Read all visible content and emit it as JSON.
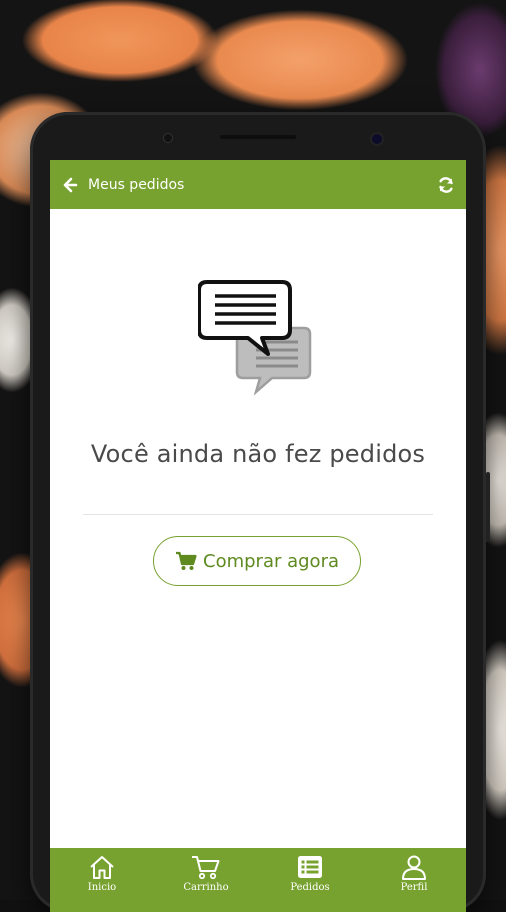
{
  "appbar": {
    "title": "Meus pedidos",
    "back_icon": "arrow-left-icon",
    "refresh_icon": "refresh-icon",
    "color": "#78a22f"
  },
  "empty_state": {
    "icon": "chat-bubbles-icon",
    "message": "Você ainda não fez pedidos"
  },
  "cta": {
    "icon": "cart-icon",
    "label": "Comprar agora"
  },
  "bottom_nav": [
    {
      "label": "Inicio",
      "icon": "home-icon"
    },
    {
      "label": "Carrinho",
      "icon": "cart-icon"
    },
    {
      "label": "Pedidos",
      "icon": "list-icon",
      "active": true
    },
    {
      "label": "Perfil",
      "icon": "user-icon"
    }
  ]
}
